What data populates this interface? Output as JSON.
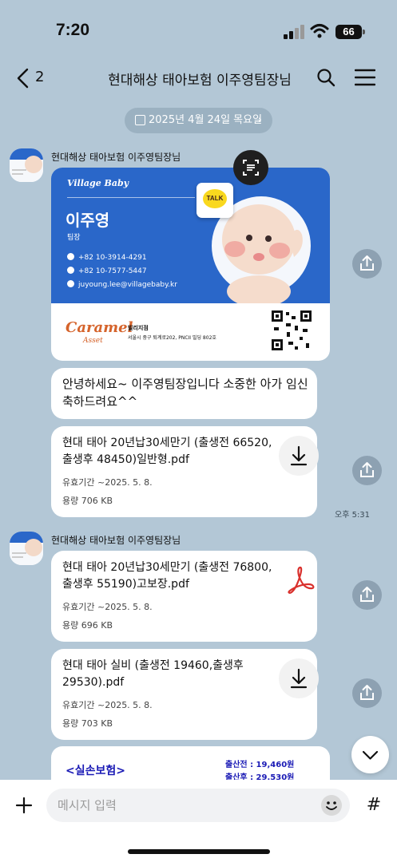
{
  "status": {
    "time": "7:20",
    "battery": "66"
  },
  "header": {
    "back_count": "2",
    "title": "현대해상 태아보험 이주영팀장님"
  },
  "date_divider": "2025년 4월 24일 목요일",
  "sender": "현대해상 태아보험 이주영팀장님",
  "card": {
    "brand": "Village Baby",
    "name": "이주영",
    "role": "팀장",
    "phones": [
      "+82 10-3914-4291",
      "+82 10-7577-5447"
    ],
    "email": "juyoung.lee@villagebaby.kr",
    "talk": "TALK",
    "company": "Caramel",
    "company_sub": "Asset",
    "branch": "빌리지점",
    "address": "서울시 중구 퇴계로202, PNCII 빌딩 802호"
  },
  "messages": {
    "greeting": "안녕하세요~ 이주영팀장입니다 소중한 아가 임신축하드려요^^",
    "time": "오후 5:31"
  },
  "files": [
    {
      "name": "현대 태아 20년납30세만기 (출생전 66520, 출생후 48450)일반형.pdf",
      "validity": "유효기간 ~2025. 5. 8.",
      "size": "용량 706 KB"
    },
    {
      "name": "현대 태아 20년납30세만기 (출생전 76800, 출생후 55190)고보장.pdf",
      "validity": "유효기간 ~2025. 5. 8.",
      "size": "용량 696 KB"
    },
    {
      "name": "현대 태아 실비 (출생전 19460,출생후 29530).pdf",
      "validity": "유효기간 ~2025. 5. 8.",
      "size": "용량 703 KB"
    }
  ],
  "image_preview": {
    "label": "<실손보험>",
    "line1": "출산전 : 19,460원",
    "line2": "출산후 : 29,530원"
  },
  "input": {
    "placeholder": "메시지 입력"
  },
  "icons": [
    "back-icon",
    "search-icon",
    "menu-icon",
    "calendar-icon",
    "share-icon",
    "download-icon",
    "pdf-icon",
    "scan-icon",
    "chevron-down-icon",
    "plus-icon",
    "emoji-icon",
    "hash-icon"
  ],
  "colors": {
    "background": "#b3c7d6",
    "card_blue": "#2a67c9",
    "talk_yellow": "#f9d81e",
    "pdf_red": "#d9302c"
  }
}
